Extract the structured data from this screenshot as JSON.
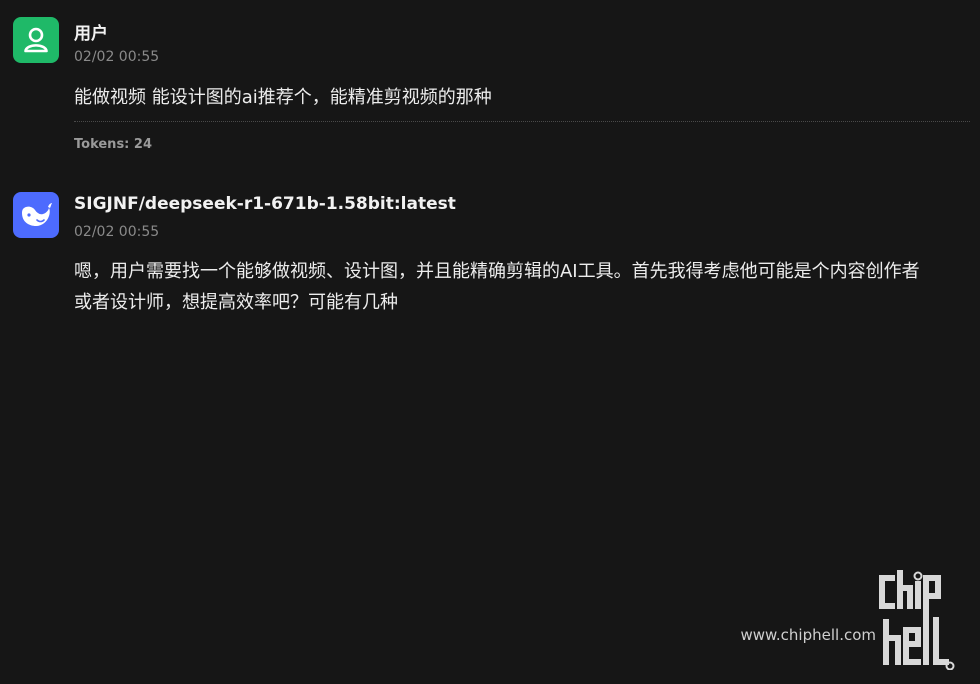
{
  "messages": {
    "user": {
      "name": "用户",
      "time": "02/02 00:55",
      "text": "能做视频 能设计图的ai推荐个，能精准剪视频的那种",
      "tokens": "Tokens: 24",
      "avatar_icon": "user-icon",
      "avatar_color": "#1fb968"
    },
    "assistant": {
      "name": "SIGJNF/deepseek-r1-671b-1.58bit:latest",
      "time": "02/02 00:55",
      "text_line1": "嗯，用户需要找一个能够做视频、设计图，并且能精确剪辑的AI工具。首先我得考虑他可能是个内容创作者",
      "text_line2": "或者设计师，想提高效率吧？可能有几种",
      "avatar_icon": "deepseek-whale-icon",
      "avatar_color": "#4d6bfe"
    }
  },
  "watermark": {
    "url": "www.chiphell.com",
    "logo_text": "chiphell"
  }
}
